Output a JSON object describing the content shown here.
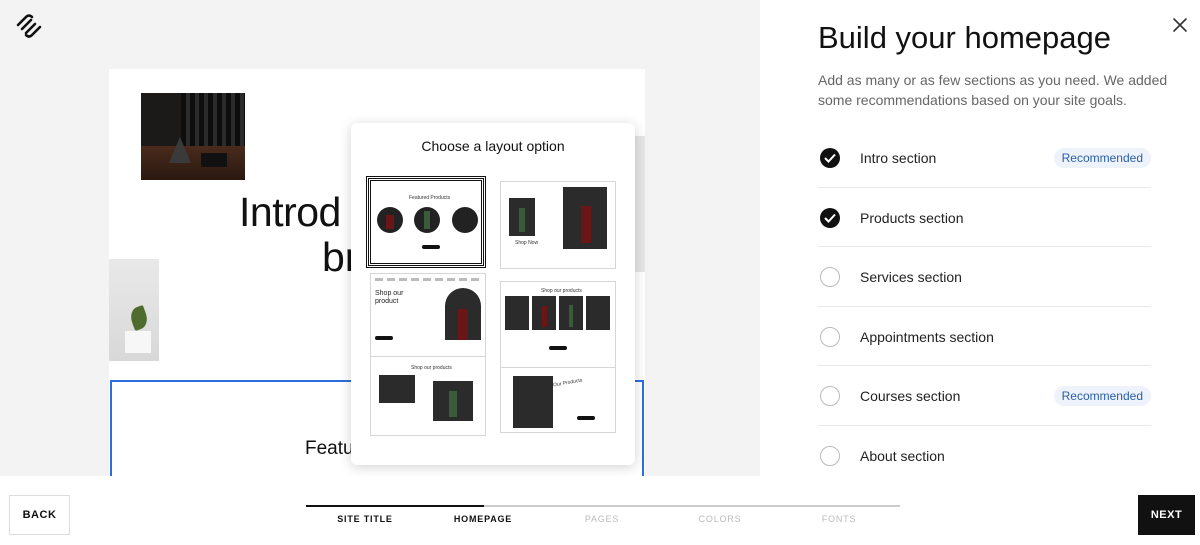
{
  "preview": {
    "hero_line1": "Introd",
    "hero_line2": "br",
    "featured_text": "Featur"
  },
  "layout_popup": {
    "title": "Choose a layout option",
    "options": [
      {
        "label": "Featured Products",
        "selected": true
      },
      {
        "label": "Shop Now",
        "selected": false
      },
      {
        "label": "Shop our product",
        "selected": false
      },
      {
        "label": "Shop our products",
        "selected": false
      },
      {
        "label": "Shop our products",
        "selected": false
      },
      {
        "label": "Our Products",
        "selected": false
      }
    ]
  },
  "panel": {
    "title": "Build your homepage",
    "description": "Add as many or as few sections as you need. We added some recommendations based on your site goals.",
    "sections": [
      {
        "label": "Intro section",
        "checked": true,
        "badge": "Recommended"
      },
      {
        "label": "Products section",
        "checked": true,
        "badge": ""
      },
      {
        "label": "Services section",
        "checked": false,
        "badge": ""
      },
      {
        "label": "Appointments section",
        "checked": false,
        "badge": ""
      },
      {
        "label": "Courses section",
        "checked": false,
        "badge": "Recommended"
      },
      {
        "label": "About section",
        "checked": false,
        "badge": ""
      }
    ]
  },
  "footer": {
    "back_label": "BACK",
    "next_label": "NEXT",
    "progress_fraction": 0.3,
    "steps": [
      {
        "label": "SITE TITLE",
        "done": true
      },
      {
        "label": "HOMEPAGE",
        "done": true
      },
      {
        "label": "PAGES",
        "done": false
      },
      {
        "label": "COLORS",
        "done": false
      },
      {
        "label": "FONTS",
        "done": false
      }
    ]
  },
  "colors": {
    "accent_blue": "#2a6fdb",
    "badge_text": "#2a5ea8",
    "badge_bg": "#eef3fb",
    "primary": "#111111"
  },
  "icons": {
    "logo": "squarespace-logo-icon",
    "close": "close-icon",
    "check": "check-icon"
  }
}
